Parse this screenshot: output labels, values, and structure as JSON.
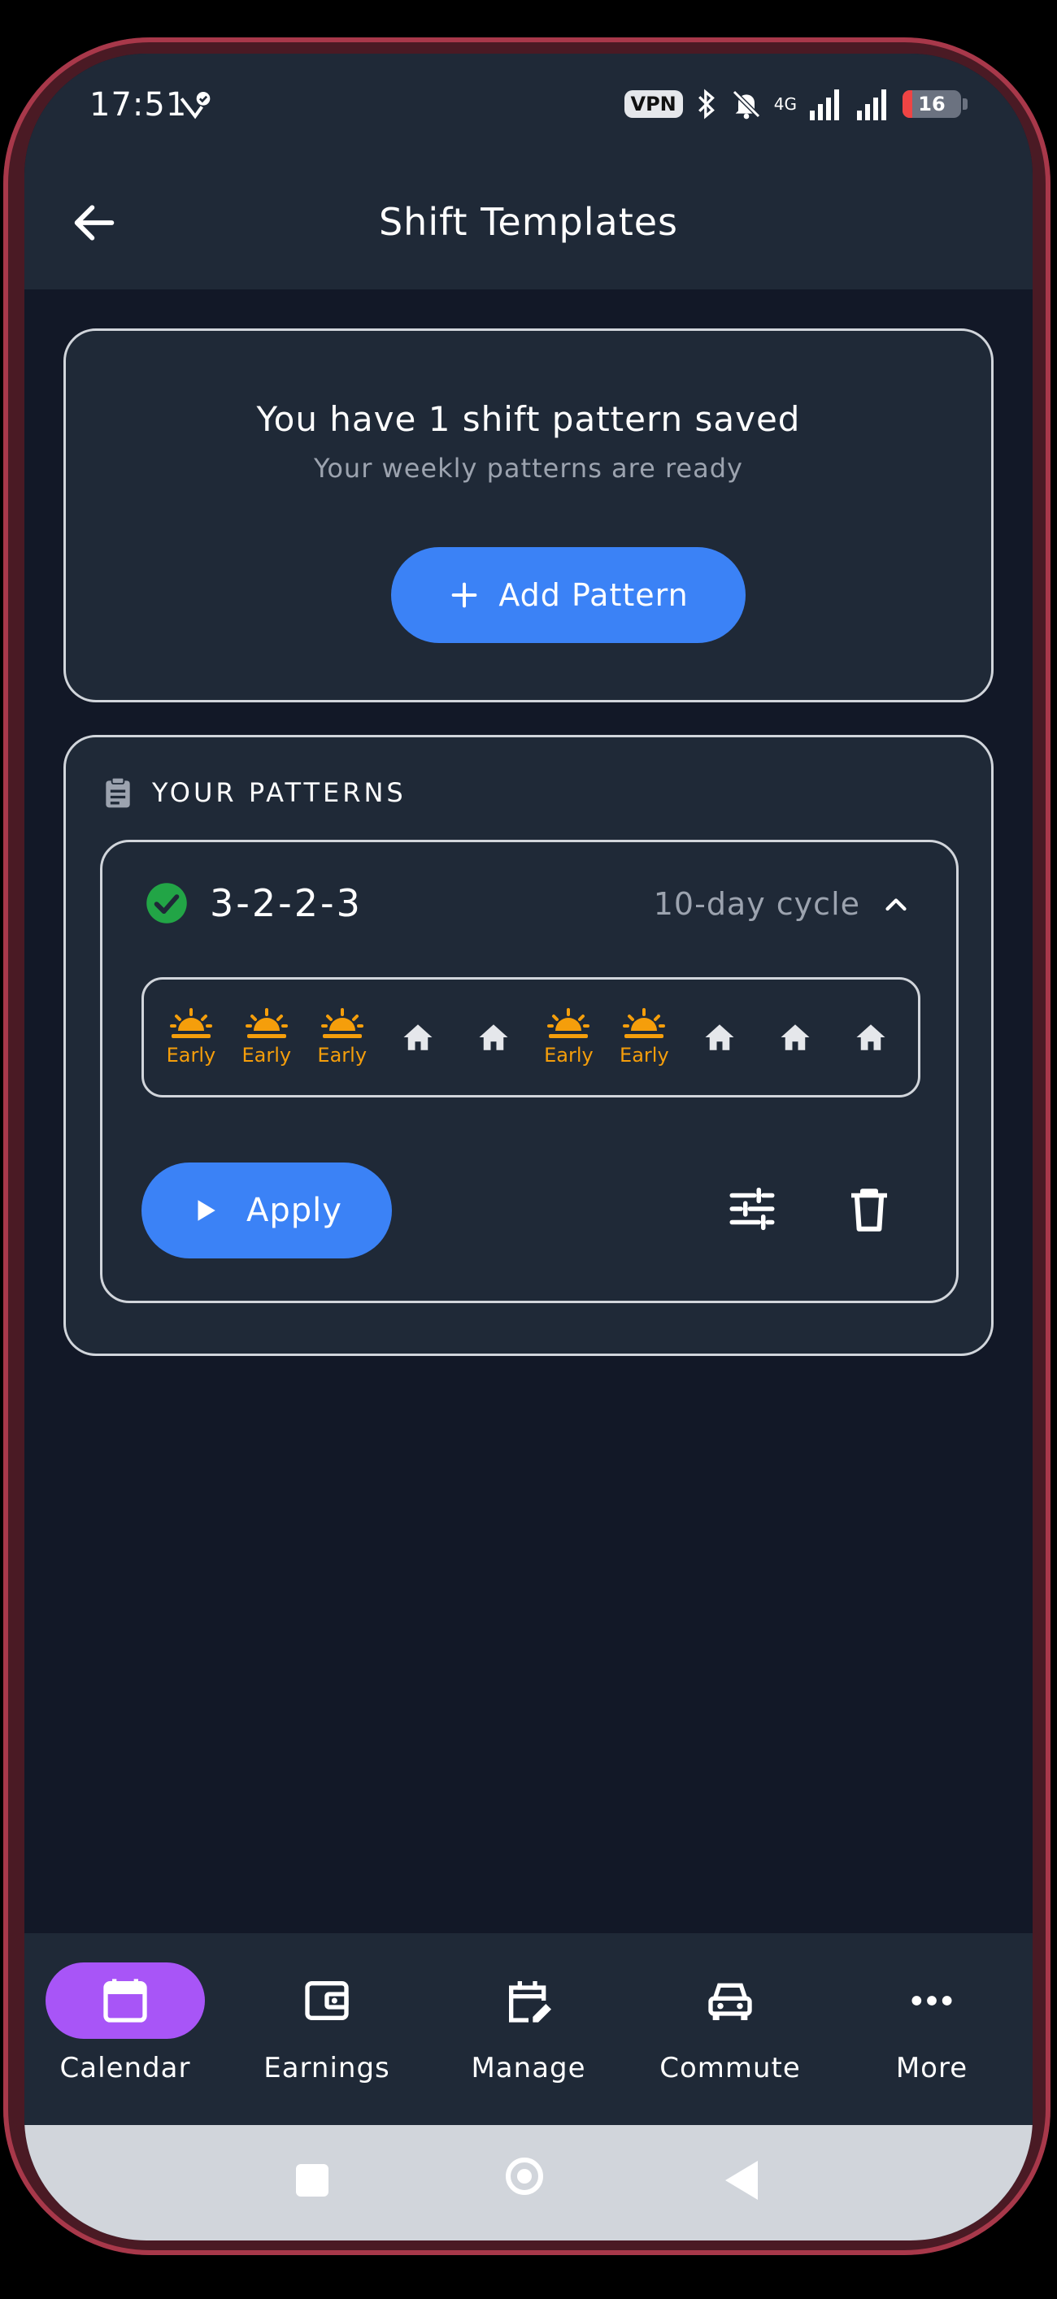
{
  "status_bar": {
    "time": "17:51",
    "vpn": "VPN",
    "network": "4G",
    "battery": "16",
    "battery_level": 0.16
  },
  "app_bar": {
    "title": "Shift Templates"
  },
  "summary": {
    "headline": "You have 1 shift pattern saved",
    "subtitle": "Your weekly patterns are ready",
    "add_button": "Add Pattern"
  },
  "patterns_section": {
    "heading": "YOUR PATTERNS",
    "pattern": {
      "name": "3-2-2-3",
      "cycle": "10-day cycle",
      "days": [
        {
          "type": "early",
          "label": "Early"
        },
        {
          "type": "early",
          "label": "Early"
        },
        {
          "type": "early",
          "label": "Early"
        },
        {
          "type": "off",
          "label": ""
        },
        {
          "type": "off",
          "label": ""
        },
        {
          "type": "early",
          "label": "Early"
        },
        {
          "type": "early",
          "label": "Early"
        },
        {
          "type": "off",
          "label": ""
        },
        {
          "type": "off",
          "label": ""
        },
        {
          "type": "off",
          "label": ""
        }
      ],
      "apply_button": "Apply"
    }
  },
  "bottom_nav": {
    "items": [
      {
        "label": "Calendar",
        "icon": "calendar-icon",
        "active": true
      },
      {
        "label": "Earnings",
        "icon": "wallet-icon",
        "active": false
      },
      {
        "label": "Manage",
        "icon": "edit-calendar-icon",
        "active": false
      },
      {
        "label": "Commute",
        "icon": "car-icon",
        "active": false
      },
      {
        "label": "More",
        "icon": "more-horiz-icon",
        "active": false
      }
    ]
  },
  "colors": {
    "background": "#121827",
    "surface": "#1f2937",
    "primary": "#3b82f6",
    "nav_active": "#a855f7",
    "early_shift": "#f59e0b",
    "success": "#22a546",
    "muted_text": "#9ca3af"
  }
}
